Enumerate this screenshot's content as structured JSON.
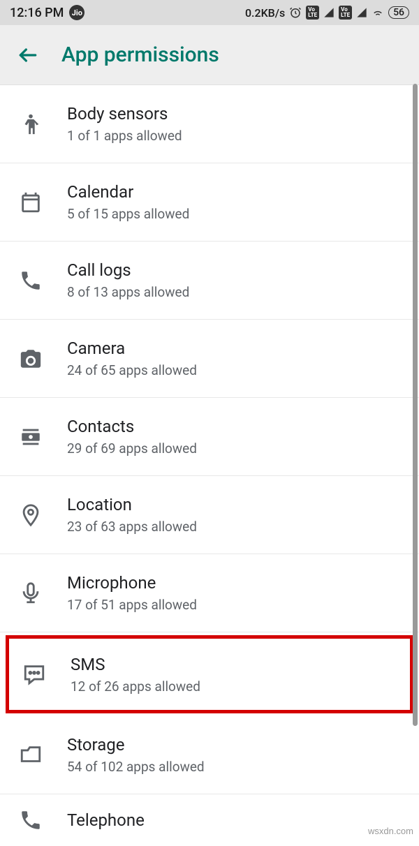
{
  "status_bar": {
    "time": "12:16 PM",
    "carrier_badge": "Jio",
    "data_speed": "0.2KB/s",
    "battery": "56"
  },
  "header": {
    "title": "App permissions"
  },
  "permissions": [
    {
      "icon": "body-sensors",
      "title": "Body sensors",
      "sub": "1 of 1 apps allowed",
      "highlighted": false
    },
    {
      "icon": "calendar",
      "title": "Calendar",
      "sub": "5 of 15 apps allowed",
      "highlighted": false
    },
    {
      "icon": "call-logs",
      "title": "Call logs",
      "sub": "8 of 13 apps allowed",
      "highlighted": false
    },
    {
      "icon": "camera",
      "title": "Camera",
      "sub": "24 of 65 apps allowed",
      "highlighted": false
    },
    {
      "icon": "contacts",
      "title": "Contacts",
      "sub": "29 of 69 apps allowed",
      "highlighted": false
    },
    {
      "icon": "location",
      "title": "Location",
      "sub": "23 of 63 apps allowed",
      "highlighted": false
    },
    {
      "icon": "microphone",
      "title": "Microphone",
      "sub": "17 of 51 apps allowed",
      "highlighted": false
    },
    {
      "icon": "sms",
      "title": "SMS",
      "sub": "12 of 26 apps allowed",
      "highlighted": true
    },
    {
      "icon": "storage",
      "title": "Storage",
      "sub": "54 of 102 apps allowed",
      "highlighted": false
    },
    {
      "icon": "telephone",
      "title": "Telephone",
      "sub": "",
      "highlighted": false
    }
  ],
  "watermark": "wsxdn.com"
}
